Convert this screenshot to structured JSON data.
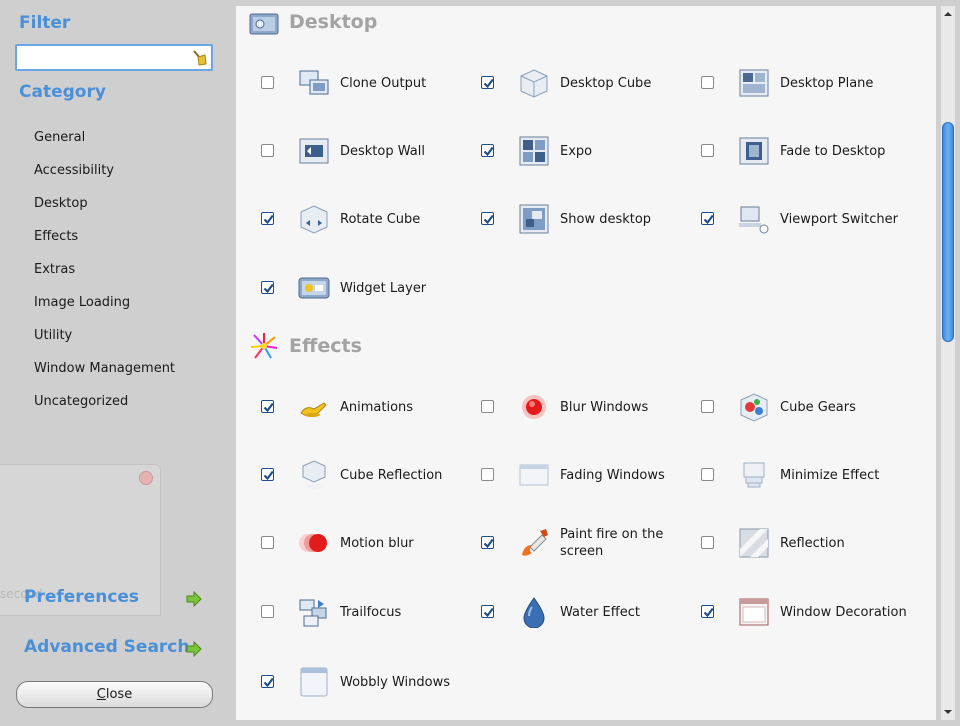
{
  "sidebar": {
    "filter_title": "Filter",
    "filter_value": "",
    "category_title": "Category",
    "categories": [
      "General",
      "Accessibility",
      "Desktop",
      "Effects",
      "Extras",
      "Image Loading",
      "Utility",
      "Window Management",
      "Uncategorized"
    ],
    "ghost_text": "second",
    "preferences_label": "Preferences",
    "advanced_search_label": "Advanced Search",
    "close_label_underlined": "C",
    "close_label_rest": "lose"
  },
  "sections": {
    "desktop": {
      "title": "Desktop",
      "plugins": [
        {
          "label": "Clone Output",
          "checked": false,
          "icon": "clone-output-icon"
        },
        {
          "label": "Desktop Cube",
          "checked": true,
          "icon": "desktop-cube-icon"
        },
        {
          "label": "Desktop Plane",
          "checked": false,
          "icon": "desktop-plane-icon"
        },
        {
          "label": "Desktop Wall",
          "checked": false,
          "icon": "desktop-wall-icon"
        },
        {
          "label": "Expo",
          "checked": true,
          "icon": "expo-icon"
        },
        {
          "label": "Fade to Desktop",
          "checked": false,
          "icon": "fade-to-desktop-icon"
        },
        {
          "label": "Rotate Cube",
          "checked": true,
          "icon": "rotate-cube-icon"
        },
        {
          "label": "Show desktop",
          "checked": true,
          "icon": "show-desktop-icon"
        },
        {
          "label": "Viewport Switcher",
          "checked": true,
          "icon": "viewport-switcher-icon"
        },
        {
          "label": "Widget Layer",
          "checked": true,
          "icon": "widget-layer-icon"
        }
      ]
    },
    "effects": {
      "title": "Effects",
      "plugins": [
        {
          "label": "Animations",
          "checked": true,
          "icon": "animations-icon"
        },
        {
          "label": "Blur Windows",
          "checked": false,
          "icon": "blur-windows-icon"
        },
        {
          "label": "Cube Gears",
          "checked": false,
          "icon": "cube-gears-icon"
        },
        {
          "label": "Cube Reflection",
          "checked": true,
          "icon": "cube-reflection-icon"
        },
        {
          "label": "Fading Windows",
          "checked": false,
          "icon": "fading-windows-icon"
        },
        {
          "label": "Minimize Effect",
          "checked": false,
          "icon": "minimize-effect-icon"
        },
        {
          "label": "Motion blur",
          "checked": false,
          "icon": "motion-blur-icon"
        },
        {
          "label": "Paint fire on the screen",
          "checked": true,
          "icon": "paint-fire-icon"
        },
        {
          "label": "Reflection",
          "checked": false,
          "icon": "reflection-icon"
        },
        {
          "label": "Trailfocus",
          "checked": false,
          "icon": "trailfocus-icon"
        },
        {
          "label": "Water Effect",
          "checked": true,
          "icon": "water-effect-icon"
        },
        {
          "label": "Window Decoration",
          "checked": true,
          "icon": "window-decoration-icon"
        },
        {
          "label": "Wobbly Windows",
          "checked": true,
          "icon": "wobbly-windows-icon"
        }
      ]
    }
  },
  "colors": {
    "accent": "#4a90d9",
    "section_title": "#a3a3a3",
    "checkbox": "#1f4e8a"
  }
}
